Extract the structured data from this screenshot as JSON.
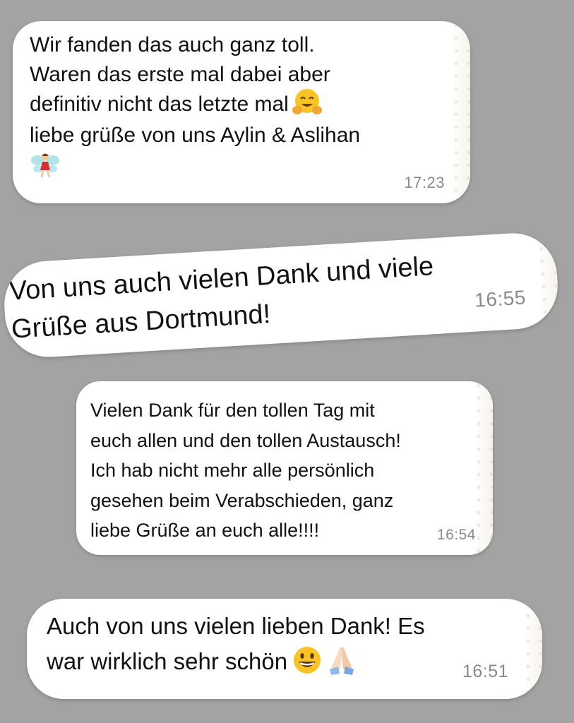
{
  "messages": [
    {
      "text": "Wir fanden das auch ganz toll.\nWaren das erste mal dabei aber\ndefinitiv nicht das letzte mal",
      "text_line2": "liebe grüße von uns Aylin & Aslihan",
      "emoji_1": "hugging-face-icon",
      "emoji_2": "fairy-icon",
      "time": "17:23"
    },
    {
      "text": "Von uns auch vielen Dank und viele\nGrüße aus Dortmund!",
      "time": "16:55"
    },
    {
      "text": "Vielen Dank für den tollen Tag mit\neuch allen und den tollen Austausch!\nIch hab nicht mehr alle persönlich\ngesehen beim Verabschieden, ganz\nliebe Grüße an euch alle!!!!",
      "time": "16:54"
    },
    {
      "text": "Auch von uns vielen lieben Dank! Es\nwar wirklich sehr schön",
      "emoji_1": "grinning-face-icon",
      "emoji_2": "folded-hands-icon",
      "time": "16:51"
    }
  ],
  "colors": {
    "background": "#a3a3a3",
    "bubble": "#ffffff",
    "text": "#111111",
    "timestamp": "#8a8a8a"
  }
}
